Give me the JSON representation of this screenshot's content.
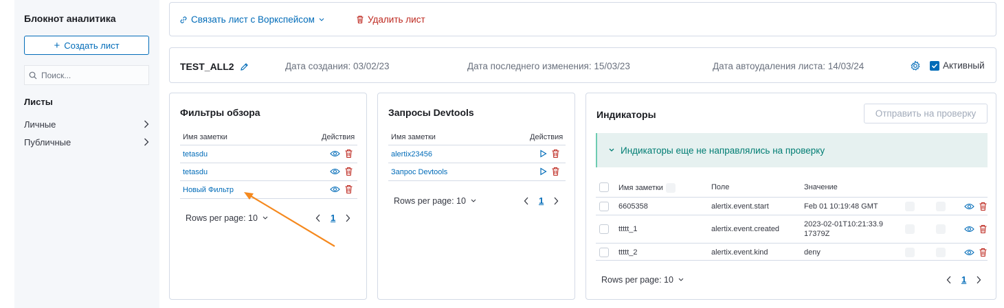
{
  "sidebar": {
    "title": "Блокнот аналитика",
    "create_label": "Создать лист",
    "search_placeholder": "Поиск...",
    "sheets_label": "Листы",
    "items": [
      {
        "label": "Личные"
      },
      {
        "label": "Публичные"
      }
    ]
  },
  "toolbar": {
    "link_label": "Связать лист с Воркспейсом",
    "delete_label": "Удалить лист"
  },
  "header": {
    "title": "TEST_ALL2",
    "created": "Дата создания: 03/02/23",
    "modified": "Дата последнего изменения: 15/03/23",
    "autodelete": "Дата автоудаления листа: 14/03/24",
    "active_label": "Активный",
    "active_checked": true
  },
  "filters": {
    "title": "Фильтры обзора",
    "col_name": "Имя заметки",
    "col_actions": "Действия",
    "rows": [
      {
        "name": "tetasdu"
      },
      {
        "name": "tetasdu"
      },
      {
        "name": "Новый Фильтр"
      }
    ],
    "rows_per_page": "Rows per page: 10",
    "page": "1"
  },
  "devtools": {
    "title": "Запросы Devtools",
    "col_name": "Имя заметки",
    "col_actions": "Действия",
    "rows": [
      {
        "name": "alertix23456"
      },
      {
        "name": "Запрос Devtools"
      }
    ],
    "rows_per_page": "Rows per page: 10",
    "page": "1"
  },
  "indicators": {
    "title": "Индикаторы",
    "submit_label": "Отправить на проверку",
    "callout": "Индикаторы еще не направлялись на проверку",
    "col_name": "Имя заметки",
    "col_field": "Поле",
    "col_value": "Значение",
    "rows": [
      {
        "name": "6605358",
        "field": "alertix.event.start",
        "value": "Feb 01 10:19:48 GMT"
      },
      {
        "name": "ttttt_1",
        "field": "alertix.event.created",
        "value": "2023-02-01T10:21:33.917379Z"
      },
      {
        "name": "ttttt_2",
        "field": "alertix.event.kind",
        "value": "deny"
      }
    ],
    "rows_per_page": "Rows per page: 10",
    "page": "1"
  },
  "colors": {
    "link": "#006bb8",
    "danger": "#bd271e",
    "success": "#017d73",
    "arrow": "#f5891e"
  }
}
